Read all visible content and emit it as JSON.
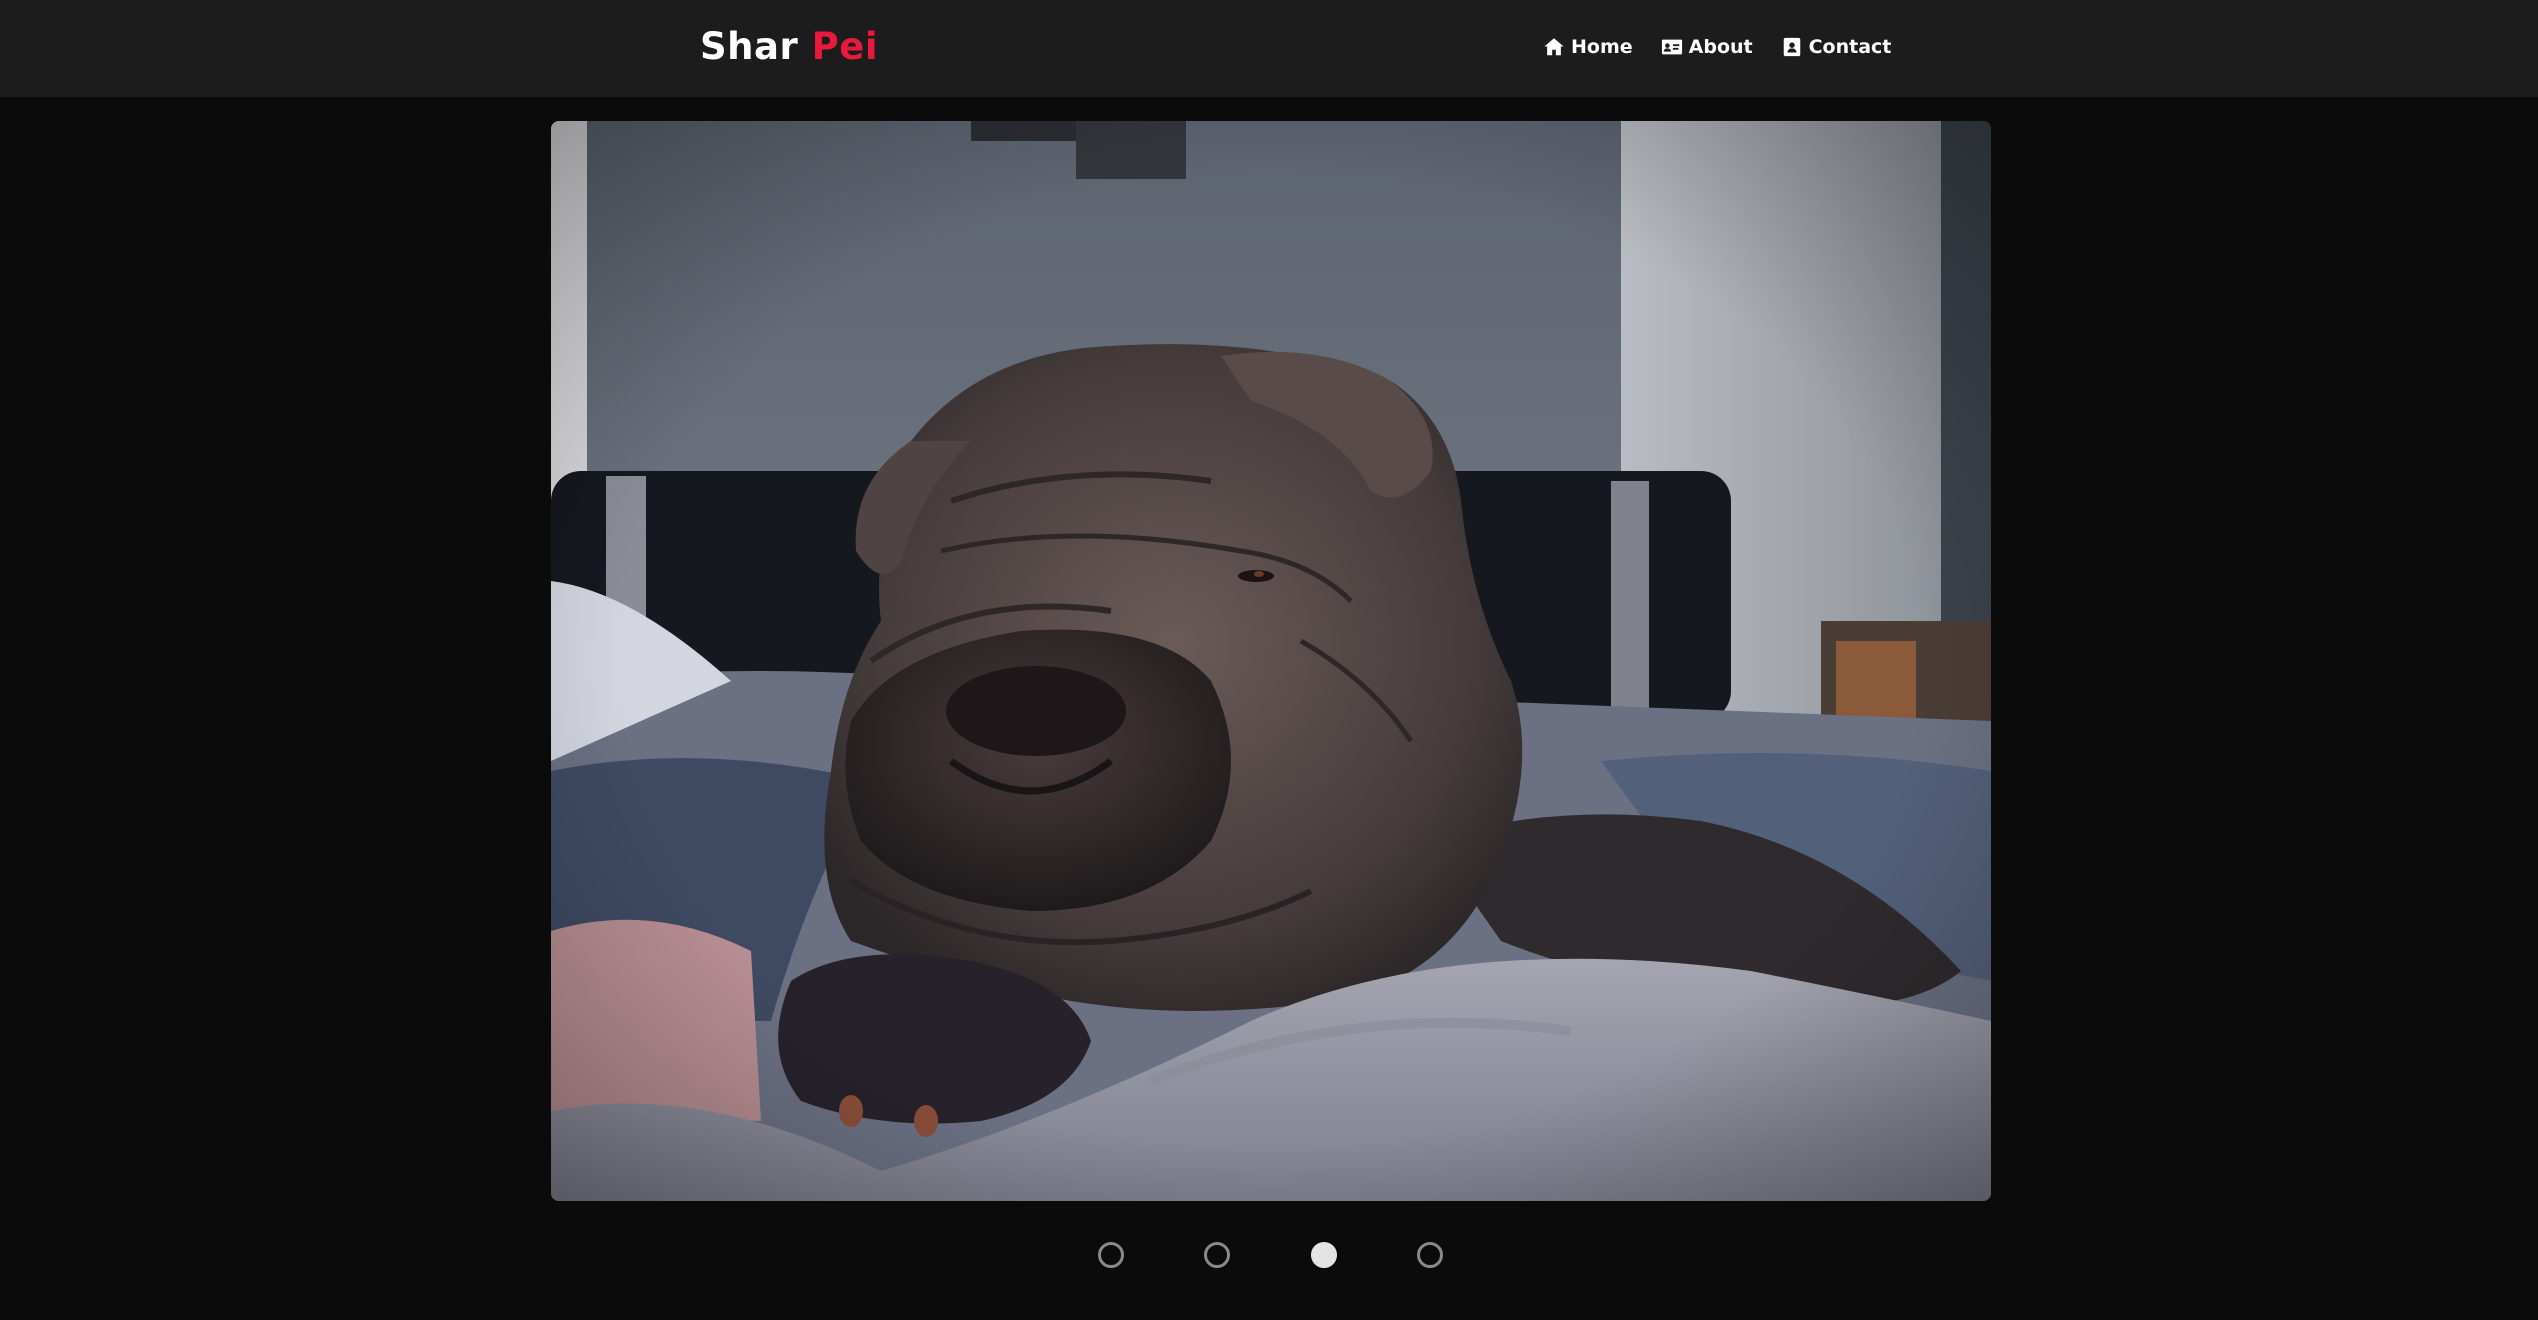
{
  "brand": {
    "first": "Shar",
    "second": "Pei"
  },
  "nav": [
    {
      "label": "Home",
      "icon": "home-icon"
    },
    {
      "label": "About",
      "icon": "id-card-icon"
    },
    {
      "label": "Contact",
      "icon": "contact-card-icon"
    }
  ],
  "slider": {
    "slide_count": 4,
    "active_index": 2
  },
  "colors": {
    "navbar_bg": "#1c1c1c",
    "page_bg": "#0b0b0b",
    "accent": "#e8193c",
    "dot_active": "#e4e4e4",
    "dot_inactive": "#8a8a8a"
  }
}
